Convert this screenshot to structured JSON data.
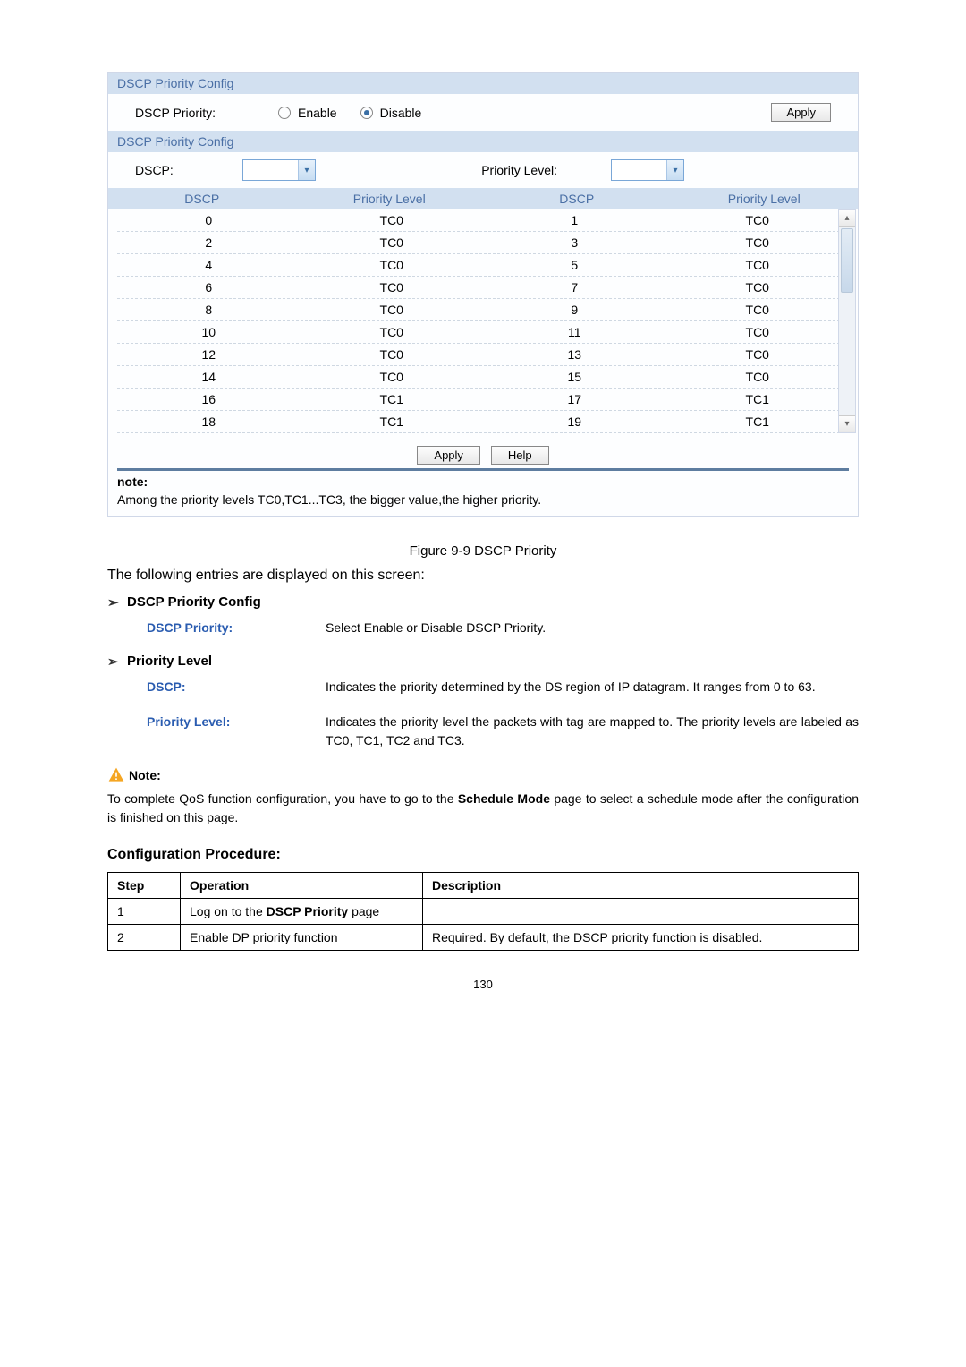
{
  "panel1": {
    "title": "DSCP Priority Config",
    "label": "DSCP Priority:",
    "option1": "Enable",
    "option2": "Disable",
    "applyLabel": "Apply"
  },
  "panel2": {
    "title": "DSCP Priority Config",
    "dscpLabel": "DSCP:",
    "priLabel": "Priority Level:",
    "head": {
      "c1": "DSCP",
      "c2": "Priority Level",
      "c3": "DSCP",
      "c4": "Priority Level"
    }
  },
  "rows": [
    {
      "a": "0",
      "ap": "TC0",
      "b": "1",
      "bp": "TC0"
    },
    {
      "a": "2",
      "ap": "TC0",
      "b": "3",
      "bp": "TC0"
    },
    {
      "a": "4",
      "ap": "TC0",
      "b": "5",
      "bp": "TC0"
    },
    {
      "a": "6",
      "ap": "TC0",
      "b": "7",
      "bp": "TC0"
    },
    {
      "a": "8",
      "ap": "TC0",
      "b": "9",
      "bp": "TC0"
    },
    {
      "a": "10",
      "ap": "TC0",
      "b": "11",
      "bp": "TC0"
    },
    {
      "a": "12",
      "ap": "TC0",
      "b": "13",
      "bp": "TC0"
    },
    {
      "a": "14",
      "ap": "TC0",
      "b": "15",
      "bp": "TC0"
    },
    {
      "a": "16",
      "ap": "TC1",
      "b": "17",
      "bp": "TC1"
    },
    {
      "a": "18",
      "ap": "TC1",
      "b": "19",
      "bp": "TC1"
    }
  ],
  "bottomBtns": {
    "apply": "Apply",
    "help": "Help"
  },
  "noteBar": {
    "hdr": "note:",
    "txt": "Among the priority levels TC0,TC1...TC3, the bigger value,the higher priority."
  },
  "caption": "Figure 9-9 DSCP Priority",
  "intro": "The following entries are displayed on this screen:",
  "sections": [
    {
      "title": "DSCP Priority Config",
      "rows": [
        {
          "k": "DSCP Priority:",
          "v": "Select Enable or Disable DSCP Priority."
        }
      ]
    },
    {
      "title": "Priority Level",
      "rows": [
        {
          "k": "DSCP:",
          "v": "Indicates the priority determined by the DS region of IP datagram. It ranges from 0 to 63."
        },
        {
          "k": "Priority Level:",
          "v": "Indicates the priority level the packets with tag are mapped to. The priority levels are labeled as TC0, TC1, TC2 and TC3."
        }
      ]
    }
  ],
  "note2": {
    "title": "Note:",
    "txt1": "To complete QoS function configuration, you have to go to the ",
    "bold": "Schedule Mode",
    "txt2": " page to select a schedule mode after the configuration is finished on this page."
  },
  "procH": "Configuration Procedure:",
  "procHead": {
    "step": "Step",
    "op": "Operation",
    "desc": "Description"
  },
  "proc": [
    {
      "step": "1",
      "op1": "Log on to the ",
      "opb": "DSCP Priority",
      "op2": " page",
      "desc": ""
    },
    {
      "step": "2",
      "op": "Enable DP priority function",
      "desc": "Required. By default, the DSCP priority function is disabled."
    }
  ],
  "pageNum": "130"
}
